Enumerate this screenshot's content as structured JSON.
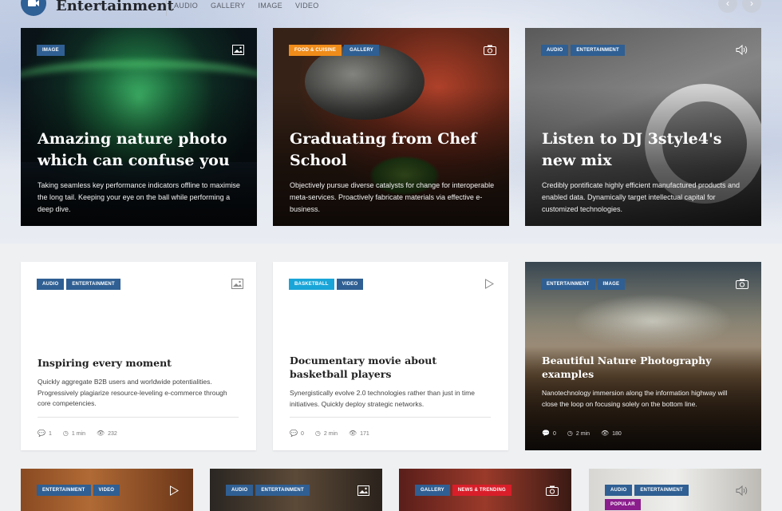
{
  "section": {
    "title": "Entertainment",
    "tabs": [
      "AUDIO",
      "GALLERY",
      "IMAGE",
      "VIDEO"
    ],
    "prev_arrow": "‹",
    "next_arrow": "›"
  },
  "featured": [
    {
      "tags": [
        "IMAGE"
      ],
      "icon": "image-icon",
      "title": "Amazing nature photo which can confuse you",
      "description": "Taking seamless key performance indicators offline to maximise the long tail. Keeping your eye on the ball while performing a deep dive."
    },
    {
      "tags": [
        "FOOD & CUISINE",
        "GALLERY"
      ],
      "icon": "camera-icon",
      "title": "Graduating from Chef School",
      "description": "Objectively pursue diverse catalysts for change for interoperable meta-services. Proactively fabricate materials via effective e-business."
    },
    {
      "tags": [
        "AUDIO",
        "ENTERTAINMENT"
      ],
      "icon": "speaker-icon",
      "title": "Listen to DJ 3style4's new mix",
      "description": "Credibly pontificate highly efficient manufactured products and enabled data. Dynamically target intellectual capital for customized technologies."
    }
  ],
  "posts": [
    {
      "tags": [
        "AUDIO",
        "ENTERTAINMENT"
      ],
      "icon": "image-icon",
      "title": "Inspiring every moment",
      "description": "Quickly aggregate B2B users and worldwide potentialities. Progressively plagiarize resource-leveling e-commerce through core competencies.",
      "comments": "1",
      "read_time": "1 min",
      "views": "232"
    },
    {
      "tags": [
        "BASKETBALL",
        "VIDEO"
      ],
      "icon": "play-icon",
      "title": "Documentary movie about basketball players",
      "description": "Synergistically evolve 2.0 technologies rather than just in time initiatives. Quickly deploy strategic networks.",
      "comments": "0",
      "read_time": "2 min",
      "views": "171"
    },
    {
      "tags": [
        "ENTERTAINMENT",
        "IMAGE"
      ],
      "icon": "camera-icon",
      "title": "Beautiful Nature Photography examples",
      "description": "Nanotechnology immersion along the information highway will close the loop on focusing solely on the bottom line.",
      "comments": "0",
      "read_time": "2 min",
      "views": "180"
    }
  ],
  "bottom": [
    {
      "tags": [
        "ENTERTAINMENT",
        "VIDEO"
      ],
      "icon": "play-icon"
    },
    {
      "tags": [
        "AUDIO",
        "ENTERTAINMENT"
      ],
      "icon": "image-icon"
    },
    {
      "tags": [
        "GALLERY",
        "NEWS & TRENDING"
      ],
      "icon": "camera-icon"
    },
    {
      "tags": [
        "AUDIO",
        "ENTERTAINMENT",
        "POPULAR"
      ],
      "icon": "speaker-icon"
    }
  ],
  "colors": {
    "brand_blue": "#2f5f93",
    "orange": "#f08c1a",
    "cyan": "#1aa5d8",
    "red": "#d91e2a",
    "purple": "#8b1d8c"
  }
}
